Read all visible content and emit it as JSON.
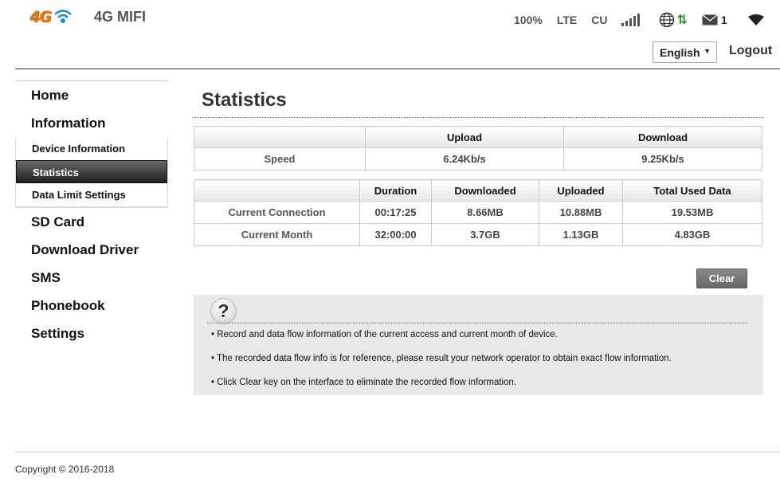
{
  "header": {
    "logo_text": "4G",
    "title": "4G MIFI",
    "battery": "100%",
    "network_type": "LTE",
    "operator": "CU",
    "signal_bars": 4,
    "message_count": "1",
    "language": "English",
    "logout_label": "Logout",
    "colors": {
      "logo": "#e87a1e",
      "data_arrows": "#2e8b2e"
    }
  },
  "sidebar": {
    "items": [
      {
        "label": "Home"
      },
      {
        "label": "Information"
      },
      {
        "label": "SD Card"
      },
      {
        "label": "Download Driver"
      },
      {
        "label": "SMS"
      },
      {
        "label": "Phonebook"
      },
      {
        "label": "Settings"
      }
    ],
    "sub_items": [
      {
        "label": "Device Information"
      },
      {
        "label": "Statistics",
        "active": true
      },
      {
        "label": "Data Limit Settings"
      }
    ]
  },
  "main": {
    "title": "Statistics",
    "speed_table": {
      "headers": [
        "",
        "Upload",
        "Download"
      ],
      "rows": [
        [
          "Speed",
          "6.24Kb/s",
          "9.25Kb/s"
        ]
      ]
    },
    "usage_table": {
      "headers": [
        "",
        "Duration",
        "Downloaded",
        "Uploaded",
        "Total Used Data"
      ],
      "rows": [
        [
          "Current Connection",
          "00:17:25",
          "8.66MB",
          "10.88MB",
          "19.53MB"
        ],
        [
          "Current Month",
          "32:00:00",
          "3.7GB",
          "1.13GB",
          "4.83GB"
        ]
      ]
    },
    "clear_label": "Clear",
    "help": {
      "icon_glyph": "?",
      "items": [
        "Record and data flow information of the current access and current month of device.",
        "The recorded data flow info is for reference, please result your network operator to obtain exact flow information.",
        "Click Clear key on the interface to eliminate the recorded flow information."
      ]
    }
  },
  "footer": {
    "copyright": "Copyright © 2016-2018"
  }
}
